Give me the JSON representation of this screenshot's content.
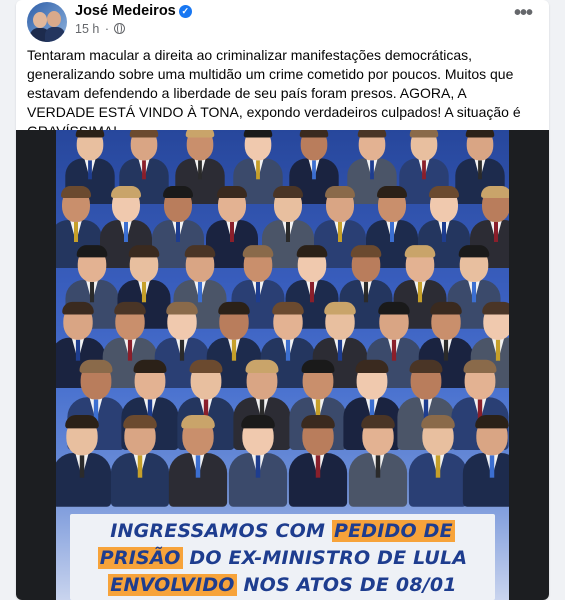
{
  "post": {
    "author": "José Medeiros",
    "timestamp": "15 h",
    "separator": "·",
    "text": "Tentaram macular a direita ao criminalizar manifestações democráticas, generalizando sobre uma multidão um crime cometido por poucos. Muitos que estavam defendendo a liberdade de seu país foram presos. AGORA, A VERDADE ESTÁ VINDO À TONA, expondo verdadeiros culpados! A situação é GRAVÍSSIMA!",
    "more_label": "•••",
    "verified_icon": "check-badge-icon",
    "privacy_icon": "globe-icon"
  },
  "banner": {
    "line1_a": "INGRESSAMOS COM ",
    "line1_b": "PEDIDO DE",
    "line2_a": "PRISÃO",
    "line2_b": " DO EX-MINISTRO DE LULA",
    "line3_a": "ENVOLVIDO",
    "line3_b": " NOS ATOS DE 08/01"
  },
  "colors": {
    "accent": "#1877f2",
    "banner_text": "#1e3d8f",
    "banner_highlight": "#f7a33a"
  }
}
